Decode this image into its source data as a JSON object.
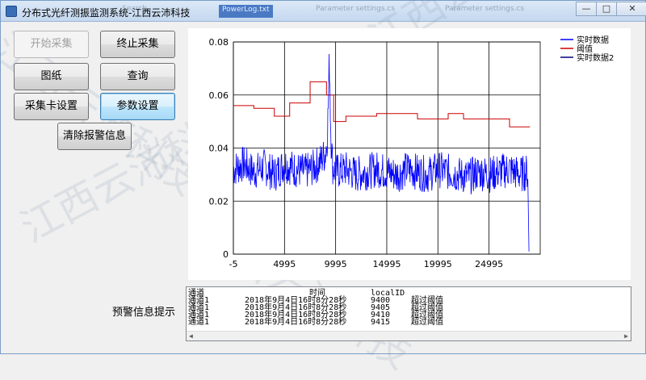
{
  "window": {
    "title": "分布式光纤测振监测系统-江西云沛科技",
    "ghost_tabs": [
      "Search...",
      "PowerLog.txt",
      "Parameter settings.cs",
      "Parameter settings.cs"
    ],
    "controls": {
      "minimize": "—",
      "maximize": "□",
      "close": "✕"
    }
  },
  "buttons": {
    "start": "开始采集",
    "stop": "终止采集",
    "drawing": "图纸",
    "query": "查询",
    "card_settings": "采集卡设置",
    "param_settings": "参数设置",
    "clear_alarm": "清除报警信息"
  },
  "alert": {
    "label": "预警信息提示",
    "headers": {
      "channel": "通道",
      "time": "时间",
      "local_id": "localID",
      "status": ""
    },
    "rows": [
      {
        "channel": "通道1",
        "time": "2018年9月4日16时8分28秒",
        "local_id": "9400",
        "status": "超过阈值"
      },
      {
        "channel": "通道1",
        "time": "2018年9月4日16时8分28秒",
        "local_id": "9405",
        "status": "超过阈值"
      },
      {
        "channel": "通道1",
        "time": "2018年9月4日16时8分28秒",
        "local_id": "9410",
        "status": "超过阈值"
      },
      {
        "channel": "通道1",
        "time": "2018年9月4日16时8分28秒",
        "local_id": "9415",
        "status": "超过阈值"
      }
    ]
  },
  "watermark": "江西云沛科技",
  "chart_data": {
    "type": "line",
    "title": "",
    "xlabel": "",
    "ylabel": "",
    "xlim": [
      -5,
      30000
    ],
    "ylim": [
      0,
      0.08
    ],
    "x_ticks": [
      "-5",
      "4995",
      "9995",
      "14995",
      "19995",
      "24995"
    ],
    "x_tick_values": [
      -5,
      4995,
      9995,
      14995,
      19995,
      24995
    ],
    "y_ticks": [
      "0",
      "0.02",
      "0.04",
      "0.06",
      "0.08"
    ],
    "y_tick_values": [
      0,
      0.02,
      0.04,
      0.06,
      0.08
    ],
    "grid": true,
    "legend_position": "top-right",
    "series": [
      {
        "name": "实时数据",
        "color": "#0000ff",
        "x": [
          -5,
          1000,
          2000,
          3000,
          4000,
          5000,
          6000,
          7000,
          8000,
          8500,
          9000,
          9200,
          9400,
          9500,
          9700,
          10000,
          11000,
          12000,
          13000,
          14000,
          15000,
          16000,
          17000,
          18000,
          19000,
          20000,
          21000,
          22000,
          23000,
          24000,
          25000,
          26000,
          27000,
          28000,
          28800,
          28900
        ],
        "y": [
          0.032,
          0.034,
          0.031,
          0.033,
          0.03,
          0.034,
          0.032,
          0.031,
          0.033,
          0.035,
          0.038,
          0.045,
          0.074,
          0.05,
          0.033,
          0.031,
          0.032,
          0.03,
          0.031,
          0.032,
          0.031,
          0.03,
          0.032,
          0.031,
          0.03,
          0.032,
          0.031,
          0.03,
          0.029,
          0.031,
          0.03,
          0.031,
          0.032,
          0.03,
          0.031,
          0.001
        ]
      },
      {
        "name": "阈值",
        "color": "#cc0000",
        "steps": [
          {
            "x0": -5,
            "x1": 2000,
            "y": 0.056
          },
          {
            "x0": 2000,
            "x1": 4000,
            "y": 0.055
          },
          {
            "x0": 4000,
            "x1": 5500,
            "y": 0.052
          },
          {
            "x0": 5500,
            "x1": 7500,
            "y": 0.057
          },
          {
            "x0": 7500,
            "x1": 9100,
            "y": 0.065
          },
          {
            "x0": 9100,
            "x1": 9800,
            "y": 0.06
          },
          {
            "x0": 9800,
            "x1": 11000,
            "y": 0.05
          },
          {
            "x0": 11000,
            "x1": 14000,
            "y": 0.052
          },
          {
            "x0": 14000,
            "x1": 18000,
            "y": 0.053
          },
          {
            "x0": 18000,
            "x1": 21000,
            "y": 0.051
          },
          {
            "x0": 21000,
            "x1": 22500,
            "y": 0.053
          },
          {
            "x0": 22500,
            "x1": 24500,
            "y": 0.051
          },
          {
            "x0": 24500,
            "x1": 27000,
            "y": 0.051
          },
          {
            "x0": 27000,
            "x1": 29000,
            "y": 0.048
          }
        ]
      },
      {
        "name": "实时数据2",
        "color": "#000080",
        "x": [],
        "y": []
      }
    ]
  }
}
